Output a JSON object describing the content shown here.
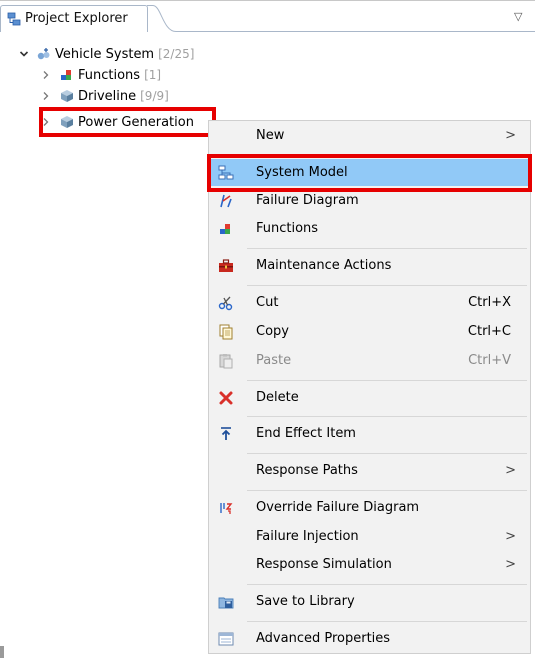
{
  "view": {
    "title": "Project Explorer",
    "menu_glyph": "▽"
  },
  "tree": {
    "root": {
      "label": "Vehicle System",
      "count": "[2/25]",
      "icon": "system-icon",
      "expanded": true
    },
    "children": [
      {
        "label": "Functions",
        "count": "[1]",
        "icon": "functions-icon"
      },
      {
        "label": "Driveline",
        "count": "[9/9]",
        "icon": "cube-icon"
      },
      {
        "label": "Power Generation",
        "count": "",
        "icon": "cube-icon",
        "selected": true
      }
    ]
  },
  "context_menu": {
    "items": {
      "new": {
        "label": "New",
        "submenu": true
      },
      "system_model": {
        "label": "System Model",
        "icon": "system-model-icon",
        "highlighted": true
      },
      "failure_diagram": {
        "label": "Failure Diagram",
        "icon": "failure-diagram-icon"
      },
      "functions": {
        "label": "Functions",
        "icon": "functions-icon"
      },
      "maintenance_actions": {
        "label": "Maintenance Actions",
        "icon": "toolbox-icon"
      },
      "cut": {
        "label": "Cut",
        "shortcut": "Ctrl+X",
        "icon": "scissors-icon"
      },
      "copy": {
        "label": "Copy",
        "shortcut": "Ctrl+C",
        "icon": "copy-icon"
      },
      "paste": {
        "label": "Paste",
        "shortcut": "Ctrl+V",
        "icon": "paste-icon",
        "disabled": true
      },
      "delete": {
        "label": "Delete",
        "icon": "delete-icon"
      },
      "end_effect_item": {
        "label": "End Effect Item",
        "icon": "arrow-up-icon"
      },
      "response_paths": {
        "label": "Response Paths",
        "submenu": true
      },
      "override_failure_diagram": {
        "label": "Override Failure Diagram",
        "icon": "override-icon"
      },
      "failure_injection": {
        "label": "Failure Injection",
        "submenu": true
      },
      "response_simulation": {
        "label": "Response Simulation",
        "submenu": true
      },
      "save_to_library": {
        "label": "Save to Library",
        "icon": "save-library-icon"
      },
      "advanced_properties": {
        "label": "Advanced Properties",
        "icon": "properties-icon"
      }
    },
    "submenu_glyph": ">"
  },
  "colors": {
    "highlight_box": "#e60000",
    "menu_hover": "#91c9f7",
    "menu_bg": "#f2f2f2",
    "count_text": "#a0a0a0"
  }
}
